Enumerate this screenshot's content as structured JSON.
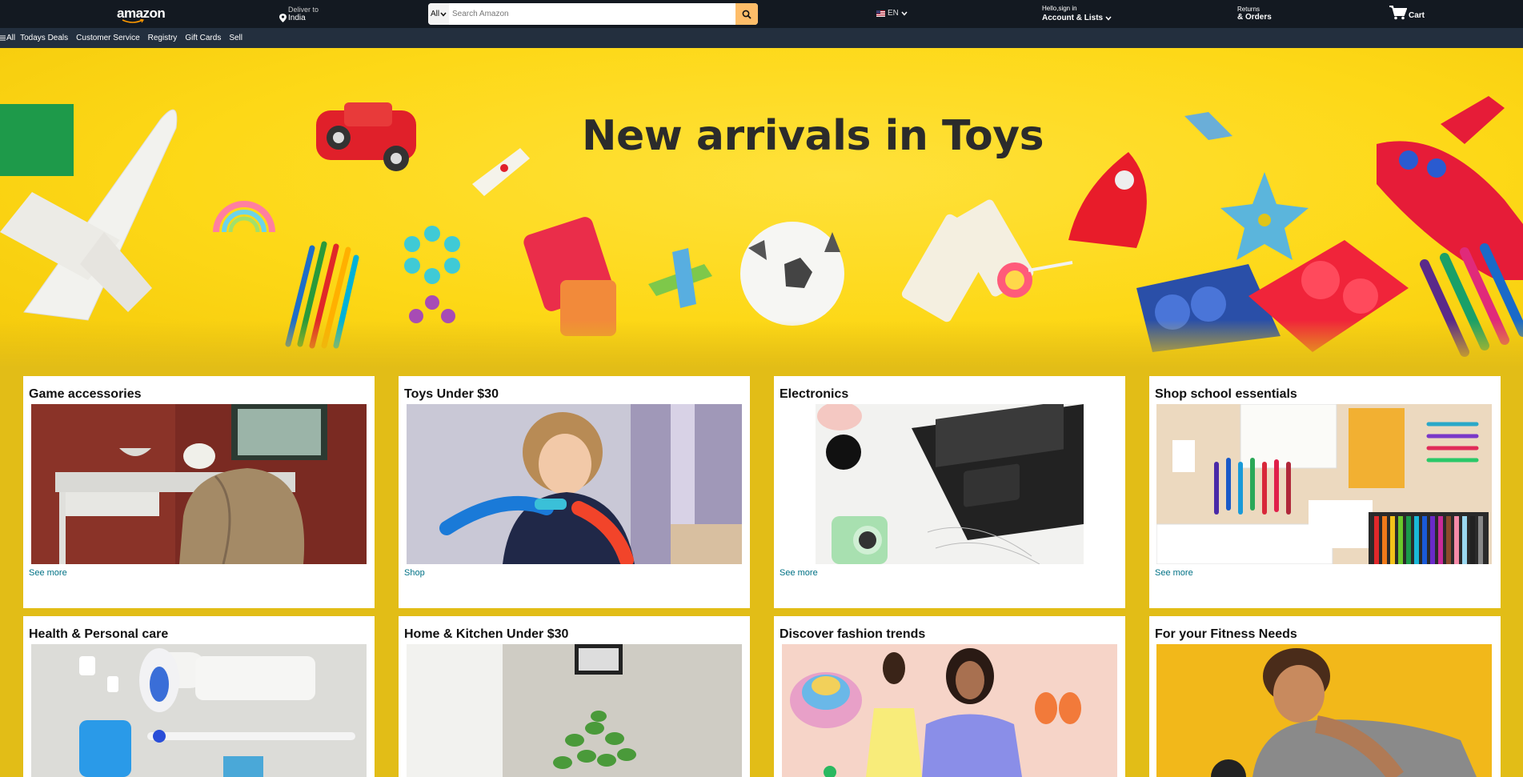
{
  "header": {
    "logo_text": "amazon",
    "deliver_label": "Deliver to",
    "deliver_location": "India",
    "search_category": "All",
    "search_placeholder": "Search Amazon",
    "language": "EN",
    "account_greeting": "Hello,sign in",
    "account_label": "Account & Lists",
    "returns_label": "Returns",
    "orders_label": "& Orders",
    "cart_label": "Cart",
    "brand_color": "#131921",
    "accent_color": "#febd69"
  },
  "subnav": {
    "all_label": "All",
    "links": [
      "Todays Deals",
      "Customer Service",
      "Registry",
      "Gift Cards",
      "Sell"
    ]
  },
  "hero": {
    "title": "New arrivals in Toys"
  },
  "cards": [
    {
      "title": "Game accessories",
      "link": "See more"
    },
    {
      "title": "Toys Under $30",
      "link": "Shop"
    },
    {
      "title": "Electronics",
      "link": "See more"
    },
    {
      "title": "Shop school essentials",
      "link": "See more"
    },
    {
      "title": "Health & Personal care",
      "link": ""
    },
    {
      "title": "Home & Kitchen Under $30",
      "link": ""
    },
    {
      "title": "Discover fashion trends",
      "link": ""
    },
    {
      "title": "For your Fitness Needs",
      "link": ""
    }
  ]
}
